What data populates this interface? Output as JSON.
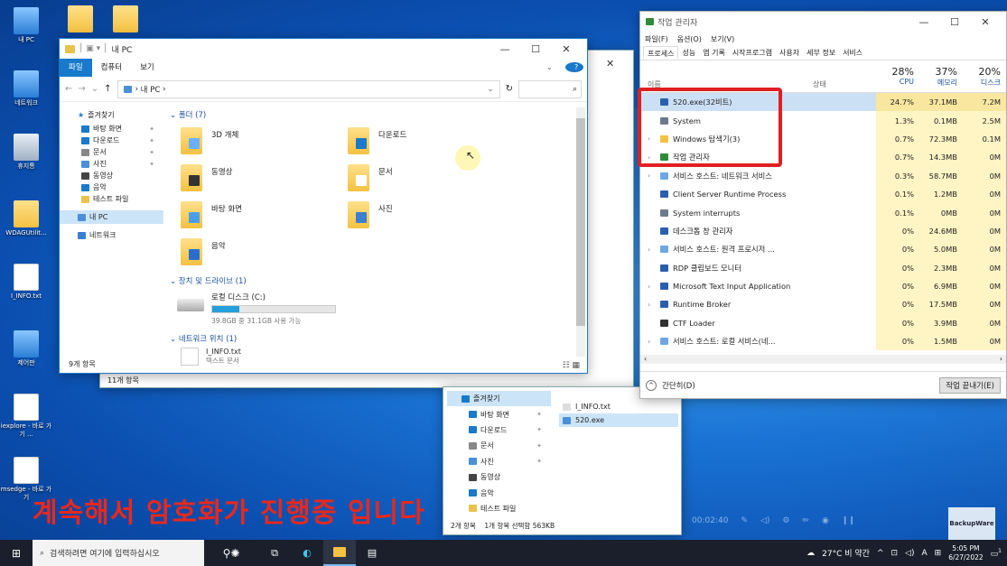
{
  "desktop_icons": [
    {
      "label": "내 PC",
      "kind": "pc"
    },
    {
      "label": "네트워크",
      "kind": "pc"
    },
    {
      "label": "휴지통",
      "kind": "bin"
    },
    {
      "label": "WDAGUtilit...",
      "kind": "user"
    },
    {
      "label": "I_INFO.txt",
      "kind": "doc"
    },
    {
      "label": "제어판",
      "kind": "pc"
    },
    {
      "label": "iexplore - 바로 가기 ...",
      "kind": "doc"
    },
    {
      "label": "msedge - 바로 가기",
      "kind": "doc"
    }
  ],
  "explorer": {
    "title": "내 PC",
    "tabs": [
      "파일",
      "컴퓨터",
      "보기"
    ],
    "address": "내 PC",
    "sidebar": {
      "quick_access": "즐겨찾기",
      "items": [
        "바탕 화면",
        "다운로드",
        "문서",
        "사진",
        "동영상",
        "음악",
        "테스트 파일"
      ],
      "this_pc": "내 PC",
      "network": "네트워크"
    },
    "folders_header": "폴더 (7)",
    "folders": [
      "3D 개체",
      "다운로드",
      "동영상",
      "문서",
      "바탕 화면",
      "사진",
      "음악"
    ],
    "devices_header": "장치 및 드라이브 (1)",
    "drive_name": "로컬 디스크 (C:)",
    "drive_free": "39.8GB 중 31.1GB 사용 가능",
    "drive_used_fraction": 0.22,
    "network_header": "네트워크 위치 (1)",
    "network_file": "I_INFO.txt",
    "network_file_sub": "텍스트 문서",
    "status": "9개 항목"
  },
  "explorer_back": {
    "status": "11개 항목"
  },
  "explorer_bottom": {
    "sidebar_items": [
      "즐겨찾기",
      "바탕 화면",
      "다운로드",
      "문서",
      "사진",
      "동영상",
      "음악",
      "테스트 파일"
    ],
    "files": [
      "I_INFO.txt",
      "520.exe"
    ],
    "status": "2개 항목    1개 항목 선택함 563KB"
  },
  "task_manager": {
    "title": "작업 관리자",
    "menu": [
      "파일(F)",
      "옵션(O)",
      "보기(V)"
    ],
    "tabs": [
      "프로세스",
      "성능",
      "앱 기록",
      "시작프로그램",
      "사용자",
      "세부 정보",
      "서비스"
    ],
    "col_name": "이름",
    "col_status": "상태",
    "cpu_pct": "28%",
    "cpu_label": "CPU",
    "mem_pct": "37%",
    "mem_label": "메모리",
    "disk_pct": "20%",
    "disk_label": "디스크",
    "rows": [
      {
        "name": "520.exe(32비트)",
        "cpu": "24.7%",
        "mem": "37.1MB",
        "disk": "7.2M",
        "exp": false,
        "hi": true
      },
      {
        "name": "System",
        "cpu": "1.3%",
        "mem": "0.1MB",
        "disk": "2.5M",
        "exp": false,
        "hi": false
      },
      {
        "name": "Windows 탐색기(3)",
        "cpu": "0.7%",
        "mem": "72.3MB",
        "disk": "0.1M",
        "exp": true,
        "hi": false
      },
      {
        "name": "작업 관리자",
        "cpu": "0.7%",
        "mem": "14.3MB",
        "disk": "0M",
        "exp": true,
        "hi": false
      },
      {
        "name": "서비스 호스트: 네트워크 서비스",
        "cpu": "0.3%",
        "mem": "58.7MB",
        "disk": "0M",
        "exp": true,
        "hi": false
      },
      {
        "name": "Client Server Runtime Process",
        "cpu": "0.1%",
        "mem": "1.2MB",
        "disk": "0M",
        "exp": false,
        "hi": false
      },
      {
        "name": "System interrupts",
        "cpu": "0.1%",
        "mem": "0MB",
        "disk": "0M",
        "exp": false,
        "hi": false
      },
      {
        "name": "데스크톱 창 관리자",
        "cpu": "0%",
        "mem": "24.6MB",
        "disk": "0M",
        "exp": false,
        "hi": false
      },
      {
        "name": "서비스 호스트: 원격 프로시저 ...",
        "cpu": "0%",
        "mem": "5.0MB",
        "disk": "0M",
        "exp": true,
        "hi": false
      },
      {
        "name": "RDP 클립보드 모니터",
        "cpu": "0%",
        "mem": "2.3MB",
        "disk": "0M",
        "exp": false,
        "hi": false
      },
      {
        "name": "Microsoft Text Input Application",
        "cpu": "0%",
        "mem": "6.9MB",
        "disk": "0M",
        "exp": true,
        "hi": false
      },
      {
        "name": "Runtime Broker",
        "cpu": "0%",
        "mem": "17.5MB",
        "disk": "0M",
        "exp": true,
        "hi": false
      },
      {
        "name": "CTF Loader",
        "cpu": "0%",
        "mem": "3.9MB",
        "disk": "0M",
        "exp": false,
        "hi": false
      },
      {
        "name": "서비스 호스트: 로컬 서비스(네...",
        "cpu": "0%",
        "mem": "1.5MB",
        "disk": "0M",
        "exp": true,
        "hi": false
      }
    ],
    "fewer_details": "간단히(D)",
    "end_task": "작업 끝내기(E)"
  },
  "caption": "계속해서 암호화가 진행중 입니다",
  "taskbar": {
    "search_placeholder": "검색하려면 여기에 입력하십시오",
    "weather": "27°C 비 약간",
    "ime": "A",
    "time": "5:05 PM",
    "date": "6/27/2022",
    "notif_count": "1"
  },
  "watermark": "BackupWare",
  "player_time": "00:02:40"
}
